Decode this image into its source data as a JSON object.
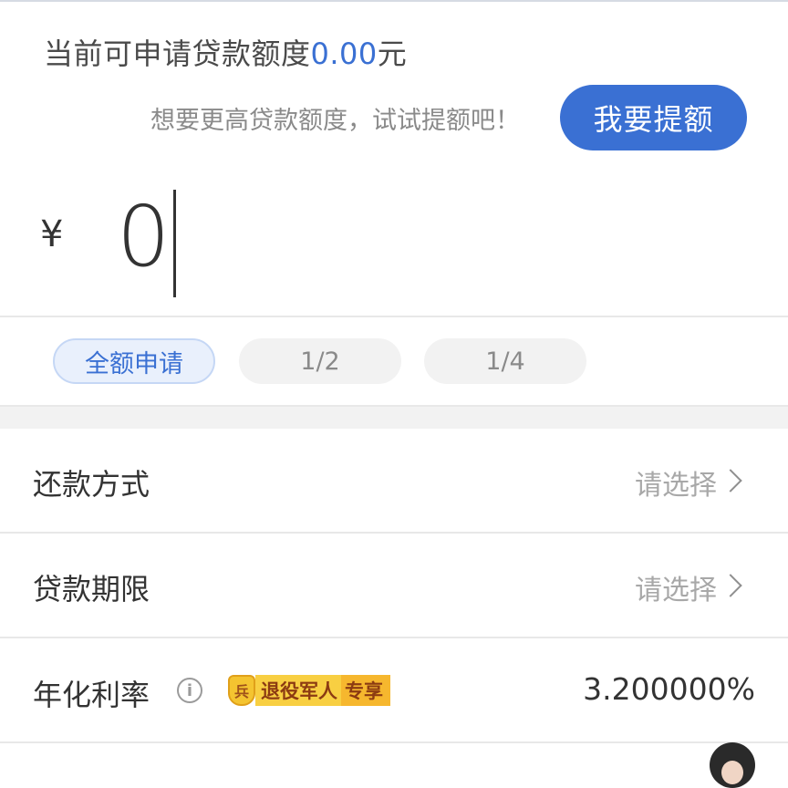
{
  "quota": {
    "prefix": "当前可申请贷款额度",
    "amount": "0.00",
    "suffix": "元"
  },
  "raise": {
    "hint": "想要更高贷款额度，试试提额吧！",
    "button_label": "我要提额"
  },
  "amount_input": {
    "currency_symbol": "¥",
    "value": "0"
  },
  "quick_chips": [
    {
      "label": "全额申请",
      "selected": true
    },
    {
      "label": "1/2",
      "selected": false
    },
    {
      "label": "1/4",
      "selected": false
    }
  ],
  "form_rows": {
    "repayment": {
      "label": "还款方式",
      "value": "请选择"
    },
    "term": {
      "label": "贷款期限",
      "value": "请选择"
    },
    "rate": {
      "label": "年化利率",
      "info_icon": "info-icon",
      "badge": {
        "part1": "退役军人",
        "part2": "专享",
        "icon": "shield-badge-icon"
      },
      "value": "3.200000%"
    }
  },
  "colors": {
    "accent": "#3a70d3",
    "badge_yellow": "#f8cf42",
    "badge_text": "#8c3b12"
  }
}
